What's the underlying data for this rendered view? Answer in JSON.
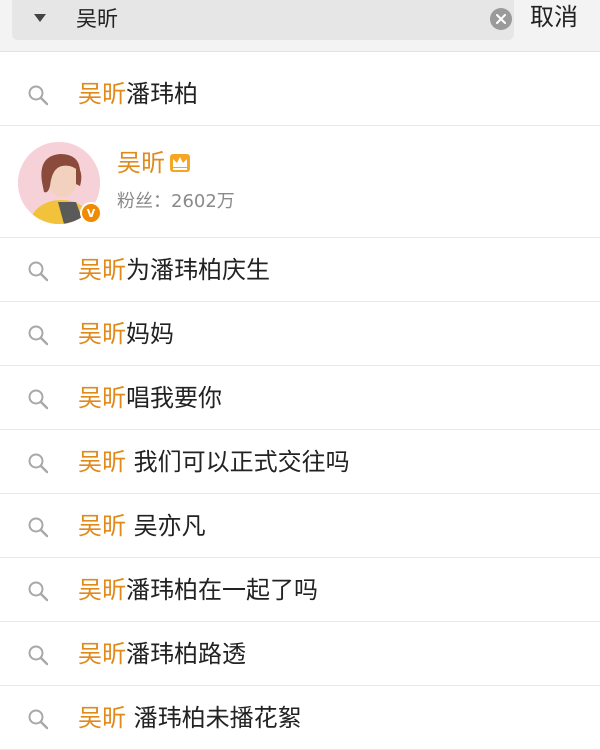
{
  "search": {
    "query": "吴昕",
    "cancel_label": "取消"
  },
  "first_suggestion": {
    "highlight": "吴昕",
    "rest": "潘玮柏"
  },
  "user": {
    "name": "吴昕",
    "fans_label": "粉丝：",
    "fans_count": "2602万",
    "badge": "V"
  },
  "suggestions": [
    {
      "highlight": "吴昕",
      "rest": "为潘玮柏庆生"
    },
    {
      "highlight": "吴昕",
      "rest": "妈妈"
    },
    {
      "highlight": "吴昕",
      "rest": "唱我要你"
    },
    {
      "highlight": "吴昕",
      "rest": " 我们可以正式交往吗"
    },
    {
      "highlight": "吴昕",
      "rest": " 吴亦凡"
    },
    {
      "highlight": "吴昕",
      "rest": "潘玮柏在一起了吗"
    },
    {
      "highlight": "吴昕",
      "rest": "潘玮柏路透"
    },
    {
      "highlight": "吴昕",
      "rest": " 潘玮柏未播花絮"
    }
  ],
  "colors": {
    "highlight": "#e08a1a",
    "badge": "#f08a00"
  }
}
